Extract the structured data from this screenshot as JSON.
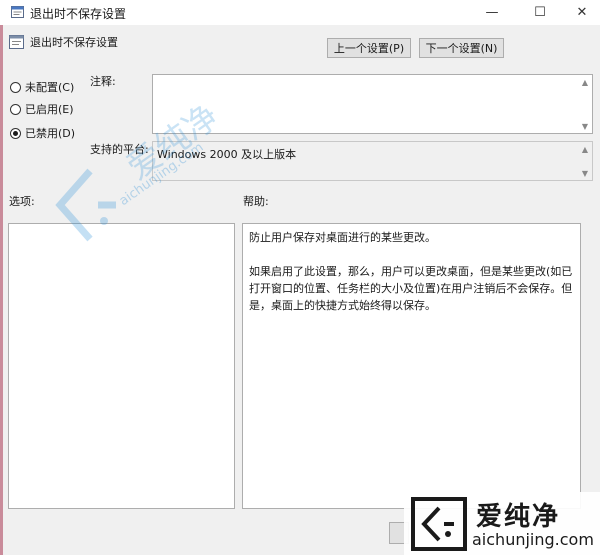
{
  "window": {
    "title": "退出时不保存设置",
    "controls": {
      "minimize": "—",
      "maximize": "☐",
      "close": "✕"
    }
  },
  "header": {
    "setting_name": "退出时不保存设置",
    "prev_button": "上一个设置(P)",
    "next_button": "下一个设置(N)"
  },
  "state": {
    "options": [
      {
        "label": "未配置(C)",
        "checked": false
      },
      {
        "label": "已启用(E)",
        "checked": false
      },
      {
        "label": "已禁用(D)",
        "checked": true
      }
    ]
  },
  "comment": {
    "label": "注释:",
    "value": ""
  },
  "platform": {
    "label": "支持的平台:",
    "value": "Windows 2000 及以上版本"
  },
  "options_pane": {
    "label": "选项:"
  },
  "help_pane": {
    "label": "帮助:",
    "paragraphs": [
      "防止用户保存对桌面进行的某些更改。",
      "如果启用了此设置，那么，用户可以更改桌面，但是某些更改(如已打开窗口的位置、任务栏的大小及位置)在用户注销后不会保存。但是，桌面上的快捷方式始终得以保存。"
    ]
  },
  "watermark": {
    "center_text_cn": "爱纯净",
    "center_text_en": "aichunjing.com",
    "corner_text_cn": "爱纯净",
    "corner_text_en": "aichunjing.com",
    "accent_color": "#2a8fd6"
  }
}
